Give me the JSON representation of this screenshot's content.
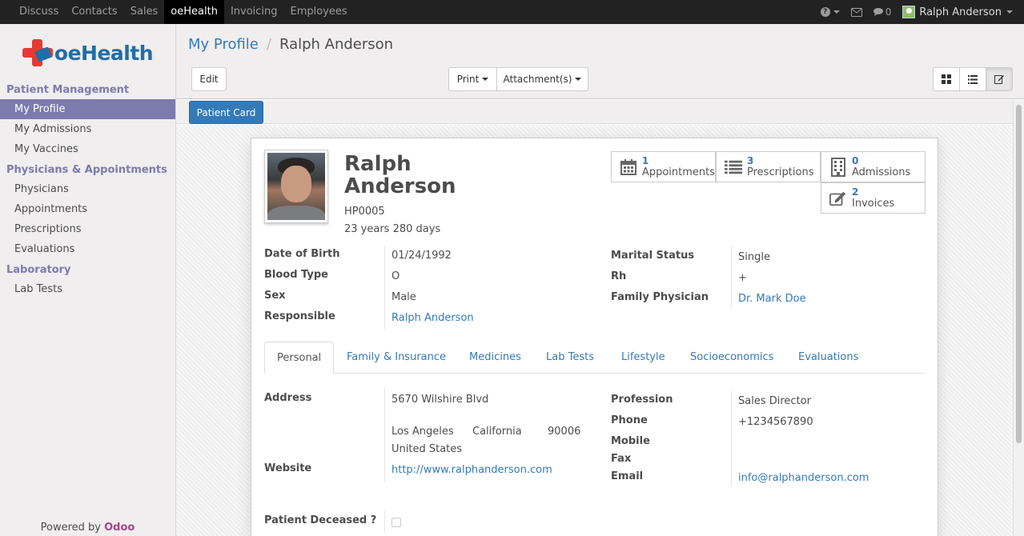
{
  "topbar": {
    "menu": [
      "Discuss",
      "Contacts",
      "Sales",
      "oeHealth",
      "Invoicing",
      "Employees"
    ],
    "active": "oeHealth",
    "help_icon": "question-icon",
    "mail_icon": "envelope-icon",
    "chat_count": "0",
    "user_name": "Ralph Anderson"
  },
  "sidebar": {
    "logo": "oeHealth",
    "sections": [
      {
        "title": "Patient Management",
        "items": [
          "My Profile",
          "My Admissions",
          "My Vaccines"
        ]
      },
      {
        "title": "Physicians & Appointments",
        "items": [
          "Physicians",
          "Appointments",
          "Prescriptions",
          "Evaluations"
        ]
      },
      {
        "title": "Laboratory",
        "items": [
          "Lab Tests"
        ]
      }
    ],
    "active_item": "My Profile",
    "powered_by": "Powered by",
    "powered_brand": "Odoo"
  },
  "control_panel": {
    "breadcrumb_root": "My Profile",
    "breadcrumb_separator": "/",
    "breadcrumb_current": "Ralph Anderson",
    "edit_label": "Edit",
    "print_label": "Print",
    "attachments_label": "Attachment(s)",
    "view_icons": [
      "kanban-icon",
      "list-icon",
      "form-icon"
    ]
  },
  "header_buttons": {
    "patient_card": "Patient Card"
  },
  "patient": {
    "first_name": "Ralph",
    "last_name": "Anderson",
    "code": "HP0005",
    "age": "23 years 280 days",
    "stats": [
      {
        "count": "1",
        "label": "Appointments",
        "icon": "calendar-icon"
      },
      {
        "count": "3",
        "label": "Prescriptions",
        "icon": "list-icon"
      },
      {
        "count": "0",
        "label": "Admissions",
        "icon": "building-icon"
      },
      {
        "count": "2",
        "label": "Invoices",
        "icon": "pencil-square-icon"
      }
    ],
    "fields_left": [
      {
        "label": "Date of Birth",
        "value": "01/24/1992"
      },
      {
        "label": "Blood Type",
        "value": "O"
      },
      {
        "label": "Sex",
        "value": "Male"
      },
      {
        "label": "Responsible",
        "value": "Ralph Anderson"
      }
    ],
    "fields_right": [
      {
        "label": "Marital Status",
        "value": "Single"
      },
      {
        "label": "Rh",
        "value": "+"
      },
      {
        "label": "Family Physician",
        "value": "Dr. Mark Doe"
      }
    ]
  },
  "tabs": [
    "Personal",
    "Family & Insurance",
    "Medicines",
    "Lab Tests",
    "Lifestyle",
    "Socioeconomics",
    "Evaluations"
  ],
  "active_tab": "Personal",
  "personal": {
    "address_label": "Address",
    "street": "5670 Wilshire Blvd",
    "city": "Los Angeles",
    "state": "California",
    "zip": "90006",
    "country": "United States",
    "website_label": "Website",
    "website": "http://www.ralphanderson.com",
    "profession_label": "Profession",
    "profession": "Sales Director",
    "phone_label": "Phone",
    "phone": "+1234567890",
    "mobile_label": "Mobile",
    "fax_label": "Fax",
    "email_label": "Email",
    "email": "info@ralphanderson.com",
    "deceased_label": "Patient Deceased ?",
    "deceased": false
  }
}
